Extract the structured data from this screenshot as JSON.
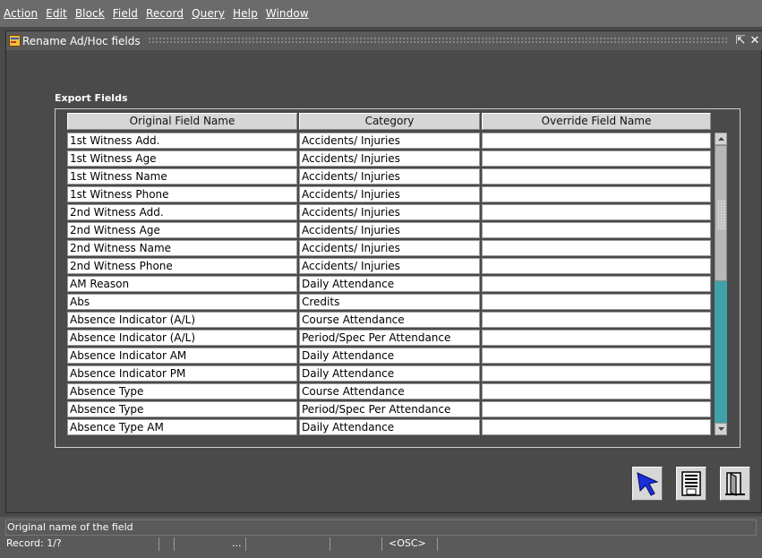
{
  "menu": [
    {
      "label": "Action"
    },
    {
      "label": "Edit"
    },
    {
      "label": "Block"
    },
    {
      "label": "Field"
    },
    {
      "label": "Record"
    },
    {
      "label": "Query"
    },
    {
      "label": "Help"
    },
    {
      "label": "Window"
    }
  ],
  "window": {
    "title": "Rename Ad/Hoc fields",
    "restore_symbol": "⇱",
    "close_symbol": "✕"
  },
  "section": {
    "label": "Export Fields"
  },
  "table": {
    "headers": [
      "Original Field Name",
      "Category",
      "Override Field Name"
    ],
    "rows": [
      {
        "original": "1st Witness Add.",
        "category": "Accidents/ Injuries",
        "override": ""
      },
      {
        "original": "1st Witness Age",
        "category": "Accidents/ Injuries",
        "override": ""
      },
      {
        "original": "1st Witness Name",
        "category": "Accidents/ Injuries",
        "override": ""
      },
      {
        "original": "1st Witness Phone",
        "category": "Accidents/ Injuries",
        "override": ""
      },
      {
        "original": "2nd Witness Add.",
        "category": "Accidents/ Injuries",
        "override": ""
      },
      {
        "original": "2nd Witness Age",
        "category": "Accidents/ Injuries",
        "override": ""
      },
      {
        "original": "2nd Witness Name",
        "category": "Accidents/ Injuries",
        "override": ""
      },
      {
        "original": "2nd Witness Phone",
        "category": "Accidents/ Injuries",
        "override": ""
      },
      {
        "original": "AM Reason",
        "category": "Daily Attendance",
        "override": ""
      },
      {
        "original": "Abs",
        "category": "Credits",
        "override": ""
      },
      {
        "original": "Absence Indicator (A/L)",
        "category": "Course Attendance",
        "override": ""
      },
      {
        "original": "Absence Indicator (A/L)",
        "category": "Period/Spec Per Attendance",
        "override": ""
      },
      {
        "original": "Absence Indicator AM",
        "category": "Daily Attendance",
        "override": ""
      },
      {
        "original": "Absence Indicator PM",
        "category": "Daily Attendance",
        "override": ""
      },
      {
        "original": "Absence Type",
        "category": "Course Attendance",
        "override": ""
      },
      {
        "original": "Absence Type",
        "category": "Period/Spec Per Attendance",
        "override": ""
      },
      {
        "original": "Absence Type AM",
        "category": "Daily Attendance",
        "override": ""
      }
    ]
  },
  "toolbar": {
    "select_icon": "pointer-arrow-icon",
    "save_icon": "save-icon",
    "exit_icon": "exit-door-icon"
  },
  "status": {
    "hint": "Original name of the field",
    "record": "Record: 1/?",
    "ellipsis": "...",
    "osc": "<OSC>"
  },
  "colors": {
    "scroll_track": "#3fa2a8",
    "pointer_blue": "#1a2fd6"
  }
}
